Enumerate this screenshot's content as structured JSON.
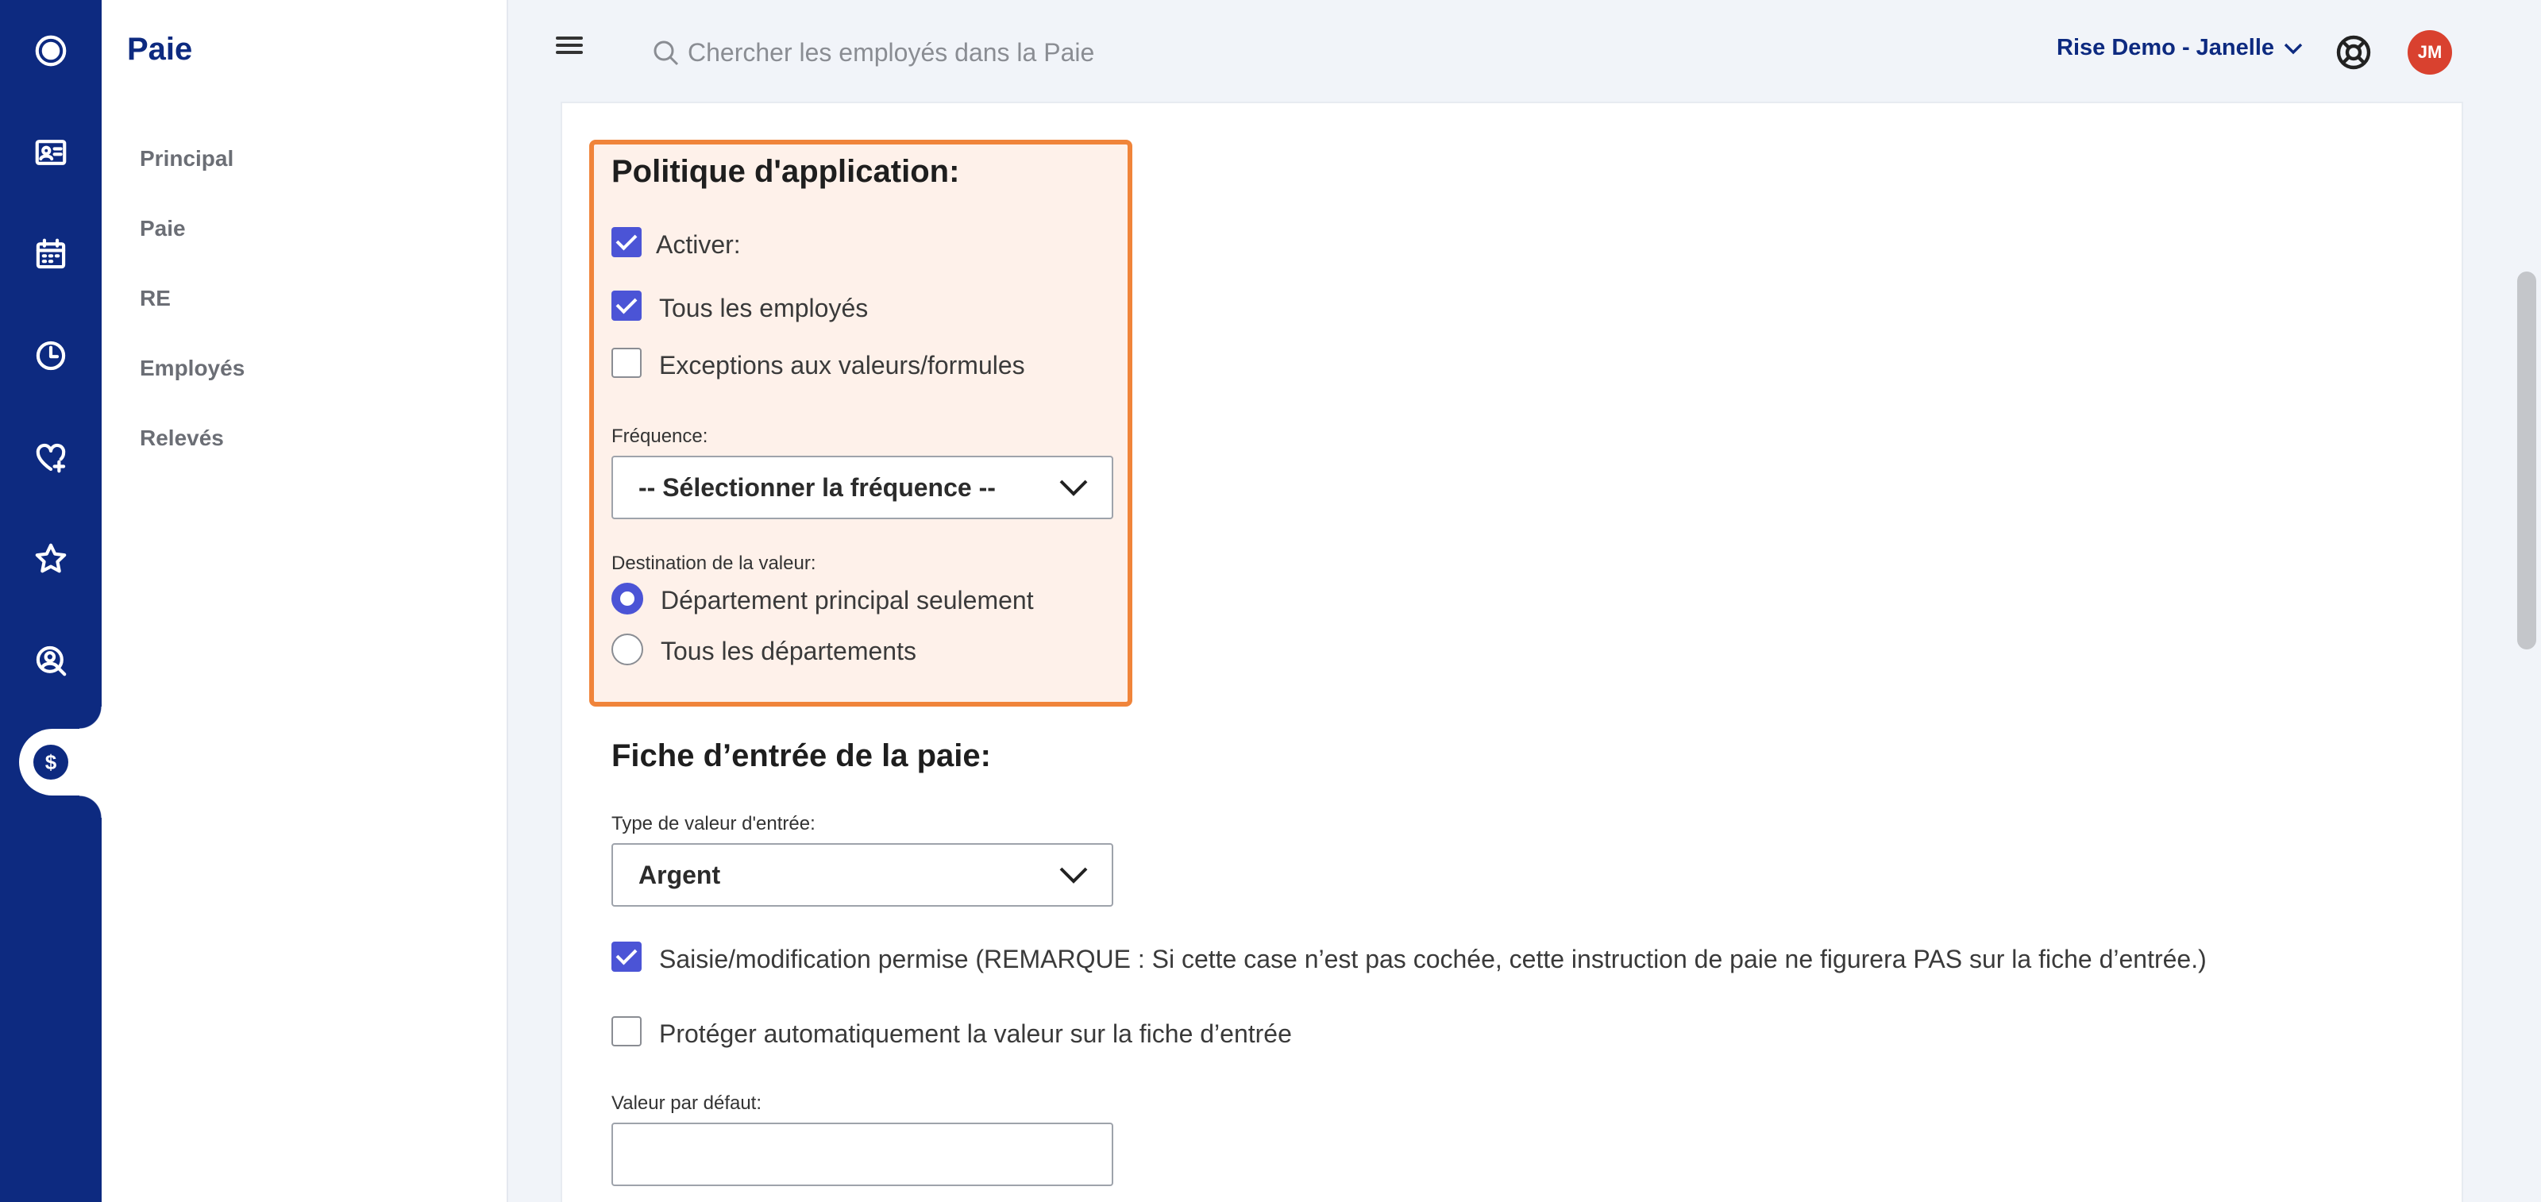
{
  "rail": {
    "icons": [
      "logo-icon",
      "id-card-icon",
      "calendar-icon",
      "clock-icon",
      "heart-plus-icon",
      "star-icon",
      "search-person-icon",
      "dollar-icon"
    ],
    "active_symbol": "$"
  },
  "sidenav": {
    "title": "Paie",
    "items": [
      {
        "label": "Principal"
      },
      {
        "label": "Paie"
      },
      {
        "label": "RE"
      },
      {
        "label": "Employés"
      },
      {
        "label": "Relevés"
      }
    ]
  },
  "header": {
    "search_placeholder": "Chercher les employés dans la Paie",
    "company": "Rise Demo - Janelle",
    "avatar_initials": "JM"
  },
  "policy": {
    "title": "Politique d'application:",
    "activate_label": "Activer:",
    "activate_checked": true,
    "all_employees_label": "Tous les employés",
    "all_employees_checked": true,
    "exceptions_label": "Exceptions aux valeurs/formules",
    "exceptions_checked": false,
    "frequency_label": "Fréquence:",
    "frequency_value": "-- Sélectionner la fréquence --",
    "destination_label": "Destination de la valeur:",
    "destination_options": [
      "Département principal seulement",
      "Tous les départements"
    ],
    "destination_selected": "Département principal seulement"
  },
  "entry": {
    "title": "Fiche d’entrée de la paie:",
    "type_label": "Type de valeur d'entrée:",
    "type_value": "Argent",
    "edit_allowed_label": "Saisie/modification permise (REMARQUE : Si cette case n’est pas cochée, cette instruction de paie ne figurera PAS sur la fiche d’entrée.)",
    "edit_allowed_checked": true,
    "protect_label": "Protéger automatiquement la valeur sur la fiche d’entrée",
    "protect_checked": false,
    "default_value_label": "Valeur par défaut:",
    "default_value": ""
  },
  "colors": {
    "brand_navy": "#0d2a80",
    "accent_purple": "#4b54d6",
    "highlight_orange": "#f0843a",
    "highlight_fill": "#fef1ea",
    "avatar_red": "#d9412f"
  }
}
